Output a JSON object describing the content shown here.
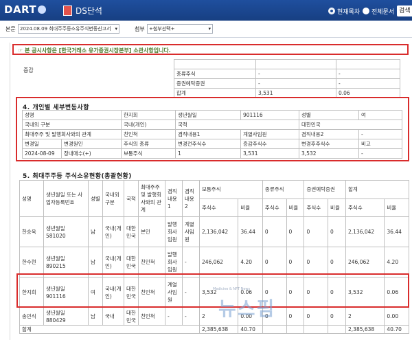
{
  "header": {
    "logo": "DART",
    "title": "DS단석",
    "radio_current": "현재목차",
    "radio_all": "전체문서",
    "search_button": "검색"
  },
  "subbar": {
    "body_label": "본문",
    "body_select": "2024.08.09  최대주주등소유주식변동신고서",
    "attach_label": "첨부",
    "attach_select": "+첨부선택+"
  },
  "notice": "☞ 본 공시사항은 [한국거래소 유가증권시장본부] 소관사항입니다.",
  "summary": {
    "left_label": "증감",
    "rows": [
      [
        "종류주식",
        "-",
        "-"
      ],
      [
        "증권예탁증권",
        "-",
        "-"
      ],
      [
        "합계",
        "3,531",
        "0.06"
      ]
    ]
  },
  "section4": {
    "title": "4. 개인별 세부변동사항",
    "rows": [
      [
        "성명",
        "한지희",
        "생년월일",
        "901116",
        "성별",
        "여"
      ],
      [
        "국내외 구분",
        "국내(개인)",
        "국적",
        "대한민국"
      ],
      [
        "최대주주 및 발행회사와의 관계",
        "친인척",
        "겸직내용1",
        "계열사임원",
        "겸직내용2",
        "-"
      ],
      [
        "변경일",
        "변경원인",
        "주식의 종류",
        "변경전주식수",
        "증감주식수",
        "변경후주식수",
        "비고"
      ],
      [
        "2024-08-09",
        "장내매수(+)",
        "보통주식",
        "1",
        "3,531",
        "3,532",
        "-"
      ]
    ]
  },
  "section5": {
    "title": "5. 최대주주등 주식소유현황(총괄현황)",
    "headers": {
      "name": "성명",
      "birth": "생년월일 또는 사업자등록번호",
      "gender": "성별",
      "domestic": "국내외 구분",
      "nation": "국적",
      "relation": "최대주주 및 발행회사와의 관계",
      "side1": "겸직 내용1",
      "side2": "겸직 내용2",
      "common": "보통주식",
      "kind": "종류주식",
      "dr": "증권예탁증권",
      "total": "합계",
      "shares": "주식수",
      "ratio": "비율"
    },
    "rows": [
      {
        "name": "한승욱",
        "birth_label": "생년월일",
        "birth": "581020",
        "gender": "남",
        "domestic": "국내(개인)",
        "nation": "대한민국",
        "relation": "본인",
        "side1": "발행회사임원",
        "side2": "계열사임원",
        "c_sh": "2,136,042",
        "c_r": "36.44",
        "k_sh": "0",
        "k_r": "0",
        "d_sh": "0",
        "d_r": "0",
        "t_sh": "2,136,042",
        "t_r": "36.44"
      },
      {
        "name": "한수현",
        "birth_label": "생년월일",
        "birth": "890215",
        "gender": "남",
        "domestic": "국내(개인)",
        "nation": "대한민국",
        "relation": "친인척",
        "side1": "발행회사임원",
        "side2": "-",
        "c_sh": "246,062",
        "c_r": "4.20",
        "k_sh": "0",
        "k_r": "0",
        "d_sh": "0",
        "d_r": "0",
        "t_sh": "246,062",
        "t_r": "4.20"
      },
      {
        "name": "한지희",
        "birth_label": "생년월일",
        "birth": "901116",
        "gender": "여",
        "domestic": "국내(개인)",
        "nation": "대한민국",
        "relation": "친인척",
        "side1": "계열사임원",
        "side2": "-",
        "c_sh": "3,532",
        "c_r": "0.06",
        "k_sh": "0",
        "k_r": "0",
        "d_sh": "0",
        "d_r": "0",
        "t_sh": "3,532",
        "t_r": "0.06"
      },
      {
        "name": "송민식",
        "birth_label": "생년월일",
        "birth": "880429",
        "gender": "남",
        "domestic": "국내",
        "nation": "대한민국",
        "relation": "친인척",
        "side1": "-",
        "side2": "-",
        "c_sh": "2",
        "c_r": "0.00",
        "k_sh": "0",
        "k_r": "0",
        "d_sh": "0",
        "d_r": "0",
        "t_sh": "2",
        "t_r": "0.00"
      }
    ],
    "total": {
      "label": "합계",
      "c_sh": "2,385,638",
      "c_r": "40.70",
      "t_sh": "2,385,638",
      "t_r": "40.70"
    }
  },
  "watermark": "뉴스핌",
  "watermark_small": "Medicine & NFT News"
}
